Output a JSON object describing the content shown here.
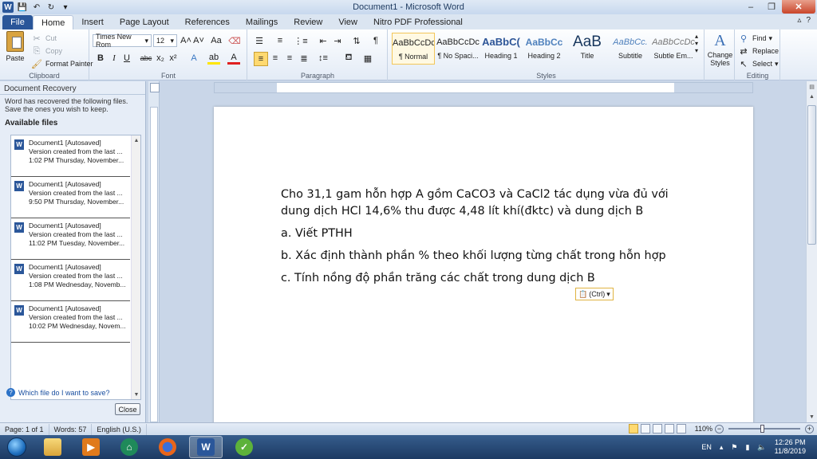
{
  "window": {
    "title": "Document1  -  Microsoft Word",
    "controls": [
      "–",
      "❐",
      "✕"
    ]
  },
  "ribbon_tabs": {
    "file": "File",
    "tabs": [
      "Home",
      "Insert",
      "Page Layout",
      "References",
      "Mailings",
      "Review",
      "View",
      "Nitro PDF Professional"
    ],
    "active": "Home"
  },
  "clipboard": {
    "paste": "Paste",
    "cut": "Cut",
    "copy": "Copy",
    "format_painter": "Format Painter",
    "label": "Clipboard"
  },
  "font": {
    "name": "Times New Rom",
    "size": "12",
    "label": "Font"
  },
  "paragraph": {
    "label": "Paragraph"
  },
  "styles": {
    "label": "Styles",
    "items": [
      {
        "sample": "AaBbCcDc",
        "name": "¶ Normal"
      },
      {
        "sample": "AaBbCcDc",
        "name": "¶ No Spaci..."
      },
      {
        "sample": "AaBbC(",
        "name": "Heading 1"
      },
      {
        "sample": "AaBbCc",
        "name": "Heading 2"
      },
      {
        "sample": "AaB",
        "name": "Title"
      },
      {
        "sample": "AaBbCc.",
        "name": "Subtitle"
      },
      {
        "sample": "AaBbCcDc",
        "name": "Subtle Em..."
      }
    ],
    "change_styles": "Change Styles"
  },
  "editing": {
    "label": "Editing",
    "find": "Find",
    "replace": "Replace",
    "select": "Select"
  },
  "recovery_pane": {
    "title": "Document Recovery",
    "description": "Word has recovered the following files.  Save the ones you wish to keep.",
    "available": "Available files",
    "files": [
      {
        "name": "Document1  [Autosaved]",
        "version": "Version created from the last ...",
        "time": "1:02 PM Thursday, November..."
      },
      {
        "name": "Document1  [Autosaved]",
        "version": "Version created from the last ...",
        "time": "9:50 PM Thursday, November..."
      },
      {
        "name": "Document1  [Autosaved]",
        "version": "Version created from the last ...",
        "time": "11:02 PM Tuesday, November..."
      },
      {
        "name": "Document1  [Autosaved]",
        "version": "Version created from the last ...",
        "time": "1:08 PM Wednesday, Novemb..."
      },
      {
        "name": "Document1  [Autosaved]",
        "version": "Version created from the last ...",
        "time": "10:02 PM Wednesday, Novem..."
      }
    ],
    "help_link": "Which file do I want to save?",
    "close": "Close"
  },
  "document": {
    "paragraphs": [
      "Cho 31,1 gam hỗn hợp A gồm CaCO3 và CaCl2 tác dụng vừa đủ với dung dịch HCl 14,6% thu được 4,48 lít khí(đktc) và dung dịch B",
      "a. Viết PTHH",
      "b. Xác định thành phần % theo khối lượng từng chất trong hỗn hợp",
      "c. Tính nồng độ phần trăng các chất trong dung dịch B"
    ],
    "paste_options": "(Ctrl)"
  },
  "status": {
    "page": "Page: 1 of 1",
    "words": "Words: 57",
    "language": "English (U.S.)",
    "zoom": "110%"
  },
  "taskbar": {
    "lang": "EN",
    "time": "12:26 PM",
    "date": "11/8/2019"
  }
}
